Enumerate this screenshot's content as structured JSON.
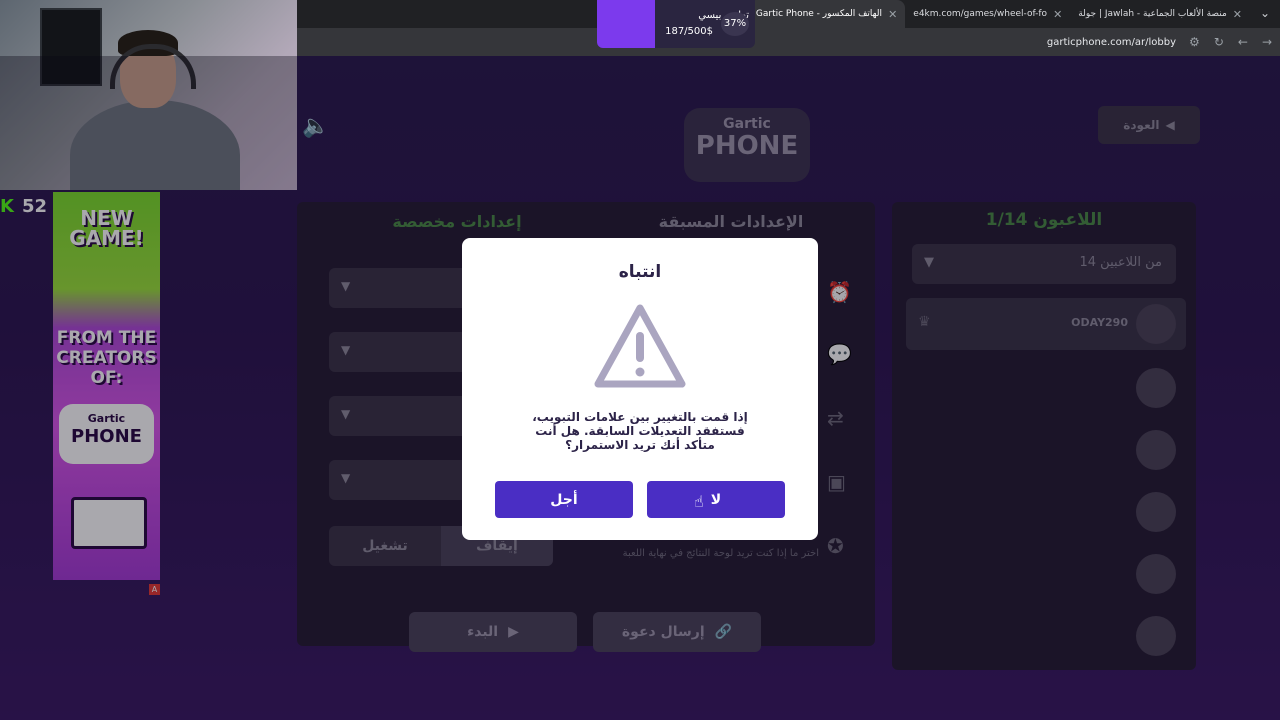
{
  "browser": {
    "tabs": [
      {
        "label": "جولة | Jawlah - منصة الألعاب الجماعية"
      },
      {
        "label": "e4km.com/games/wheel-of-fo"
      },
      {
        "label": "Gartic Phone - الهاتف المكسور",
        "active": true
      }
    ],
    "new_tab": "+",
    "url": "garticphone.com/ar/lobby"
  },
  "donation_goal": {
    "title": "تطوير بيسي",
    "amount": "187/500$",
    "percent": "37%",
    "percent_value": 37,
    "color": "#7c3aed"
  },
  "stream": {
    "viewer_count": "52",
    "ad": {
      "line1": "NEW GAME!",
      "line2": "FROM THE CREATORS OF:",
      "logo_top": "Gartic",
      "logo_bottom": "PHONE"
    }
  },
  "game": {
    "logo_top": "Gartic",
    "logo_bottom": "PHONE",
    "back_label": "العودة",
    "players": {
      "title": "اللاعبون 1/14",
      "limit_select": "14 من اللاعبين",
      "host_name": "ODAY290",
      "empty_slots": 5
    },
    "settings": {
      "tab_custom": "إعدادات مخصصة",
      "tab_preset": "الإعدادات المسبقة",
      "toggle_on": "تشغيل",
      "toggle_off": "إيقاف",
      "desc": "اختر ما إذا كنت تريد لوحة النتائج في نهاية اللعبة"
    },
    "invite_label": "إرسال دعوة",
    "start_label": "البدء"
  },
  "dialog": {
    "title": "انتباه",
    "message": "إذا قمت بالتغيير بين علامات التبويب، فستفقد التعديلات السابقة. هل أنت متأكد أنك تريد الاستمرار؟",
    "yes_label": "أجل",
    "no_label": "لا"
  },
  "colors": {
    "accent": "#4a2ec4",
    "kick_green": "#53fc18",
    "tab_green": "#4a8a46"
  }
}
